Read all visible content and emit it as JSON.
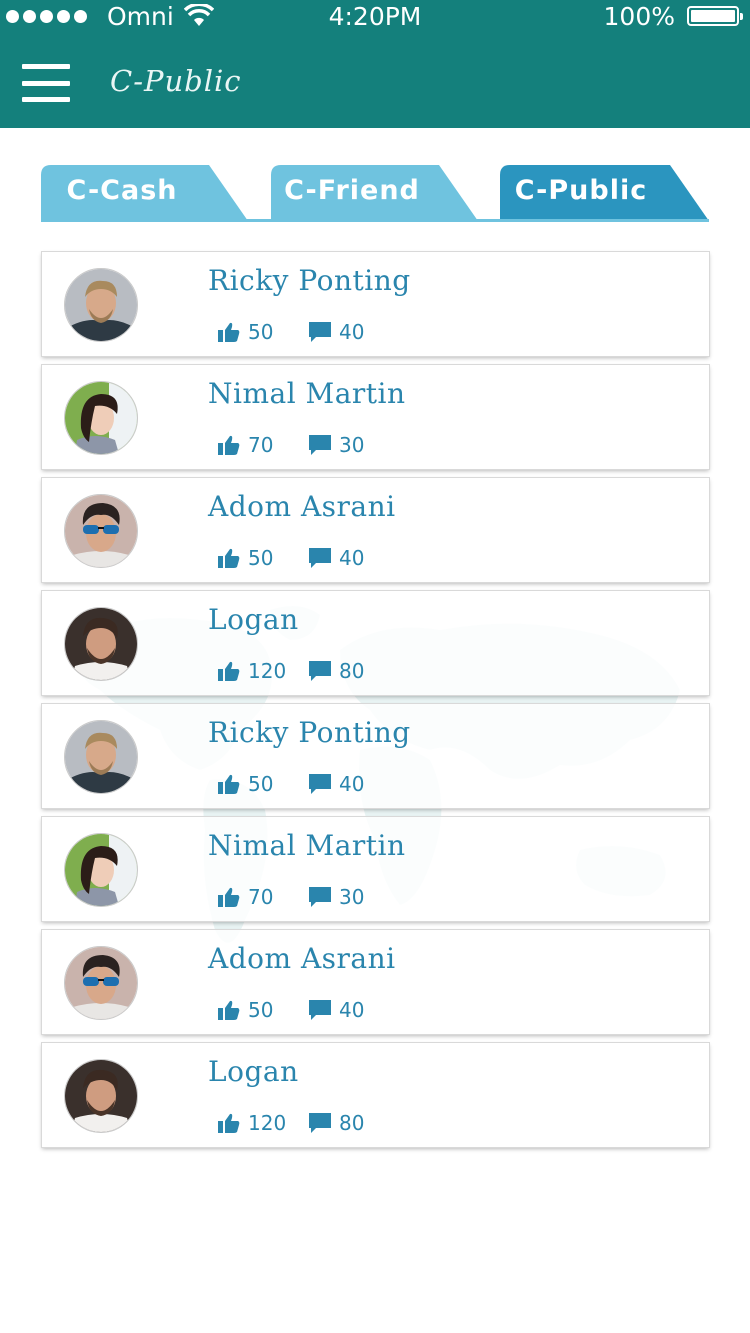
{
  "status_bar": {
    "carrier": "Omni",
    "time": "4:20PM",
    "battery": "100%"
  },
  "header": {
    "title": "C-Public",
    "menu_icon": "hamburger-menu-icon"
  },
  "tabs": [
    {
      "label": "C-Cash",
      "active": false
    },
    {
      "label": "C-Friend",
      "active": false
    },
    {
      "label": "C-Public",
      "active": true
    }
  ],
  "colors": {
    "header_bg": "#14807c",
    "tab_inactive": "#6fc3df",
    "tab_active": "#2b95bf",
    "text_accent": "#2a85ad"
  },
  "users": [
    {
      "name": "Ricky Ponting",
      "likes": "50",
      "comments": "40",
      "avatar": "man-blond"
    },
    {
      "name": "Nimal Martin",
      "likes": "70",
      "comments": "30",
      "avatar": "woman-dark-hair"
    },
    {
      "name": "Adom Asrani",
      "likes": "50",
      "comments": "40",
      "avatar": "man-sunglasses"
    },
    {
      "name": "Logan",
      "likes": "120",
      "comments": "80",
      "avatar": "man-beard"
    },
    {
      "name": "Ricky Ponting",
      "likes": "50",
      "comments": "40",
      "avatar": "man-blond"
    },
    {
      "name": "Nimal Martin",
      "likes": "70",
      "comments": "30",
      "avatar": "woman-dark-hair"
    },
    {
      "name": "Adom Asrani",
      "likes": "50",
      "comments": "40",
      "avatar": "man-sunglasses"
    },
    {
      "name": "Logan",
      "likes": "120",
      "comments": "80",
      "avatar": "man-beard"
    }
  ]
}
